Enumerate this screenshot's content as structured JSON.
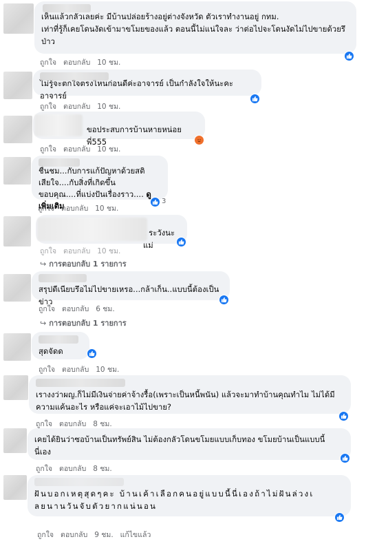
{
  "comments": [
    {
      "text": "เห็นแล้วกลัวเลยค่ะ มีบ้านปล่อยร้างอยู่ต่างจังหวัด ตัวเราทำงานอยู่ กทม.\nเท่าที่รู้ก็เคยโดนงัดเข้ามาขโมยของแล้ว ตอนนี้ไม่แน่ใจละ ว่าต่อไปจะโดนงัดไม่ไปขายด้วยรึ\nป่าว",
      "like": "ถูกใจ",
      "reply": "ตอบกลับ",
      "time": "10 ชม."
    },
    {
      "text": "ไม่รู้จะตกใจตรงไหนก่อนดีค่ะอาจารย์ เป็นกำลังใจให้นะคะอาจารย์",
      "like": "ถูกใจ",
      "reply": "ตอบกลับ",
      "time": "10 ชม."
    },
    {
      "text": "ขอประสบการบ้านหายหน่อยพี่555",
      "like": "ถูกใจ",
      "reply": "ตอบกลับ",
      "time": "10 ชม."
    },
    {
      "line1": "ชื่นชม...กับการแก้ปัญหาด้วยสติ",
      "line2": "เสียใจ....กับสิ่งที่เกิดขึ้น",
      "line3": "ขอบคุณ....ที่แบ่งปันเรื่องราว....",
      "see_more": "ดูเพิ่มเติม",
      "react_count": "3",
      "like": "ถูกใจ",
      "reply": "ตอบกลับ",
      "time": "10 ชม."
    },
    {
      "text": "t ระวังนะแม่",
      "like": "ถูกใจ",
      "reply": "ตอบกลับ",
      "time": "10 ชม.",
      "replies": "การตอบกลับ 1 รายการ"
    },
    {
      "text": "สรุปดีเนียบรึอไม่ไปขายเหรอ...กล้าเก็น..แบบนี้ต้องเป็นข่าว",
      "like": "ถูกใจ",
      "reply": "ตอบกลับ",
      "time": "6 ชม.",
      "replies": "การตอบกลับ 1 รายการ"
    },
    {
      "text": "สุดจัดด",
      "like": "ถูกใจ",
      "reply": "ตอบกลับ",
      "time": "10 ชม."
    },
    {
      "text": "เรางงว่าผญ.ก็ไม่มีเงินจ่ายค่าจ้างรื้อ(เพราะเป็นหนี้พนัน) แล้วจะมาทำบ้านคุณทำไม ไม่ได้มี\nความแค้นอะไร หรือแค่จะเอาไม้ไปขาย?",
      "like": "ถูกใจ",
      "reply": "ตอบกลับ",
      "time": "8 ชม."
    },
    {
      "text": "เคยได้ยินว่าซอบ้านเป็นทรัพย์สิน ไม่ต้องกลัวโดนขโมยแบบเก็บทอง ขโมยบ้านเป็นแบบนี้\nนี่เอง",
      "like": "ถูกใจ",
      "reply": "ตอบกลับ",
      "time": "8 ชม."
    },
    {
      "text": "ฝันบอกเหตุสุดๆคะ บ้านเค้าเลือกคนอยู่แบบนี้นี่เองถ้าไม่ฝันล่วงเ\nลยนานวันจับตัวยากแน่นอน",
      "like": "ถูกใจ",
      "reply": "ตอบกลับ",
      "time": "9 ชม.",
      "edited": "แก้ไขแล้ว"
    }
  ],
  "colors": {
    "like": "#1877f2",
    "angry": "#f0702c",
    "bubble": "#f0f2f5",
    "meta": "#65676b"
  },
  "icons": {
    "like": "thumbs-up-icon",
    "angry": "angry-face-icon",
    "reply_arrow": "reply-arrow-icon"
  }
}
